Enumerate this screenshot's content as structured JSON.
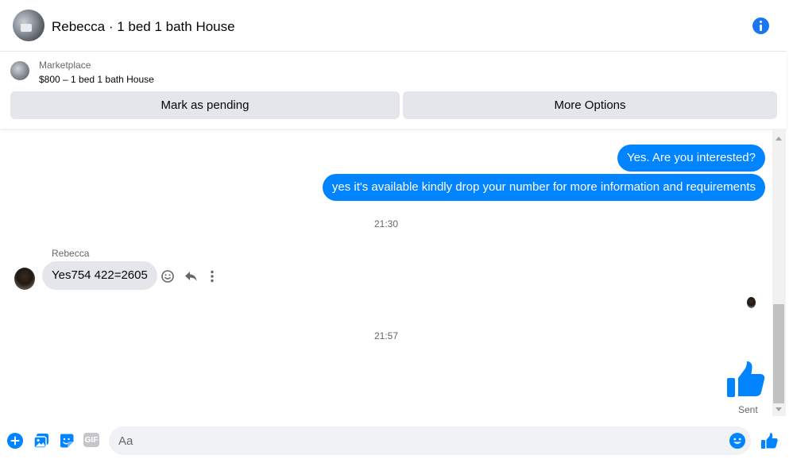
{
  "header": {
    "title": "Rebecca · 1 bed 1 bath House"
  },
  "listing": {
    "label": "Marketplace",
    "title": "$800 – 1 bed 1 bath House",
    "pending_label": "Mark as pending",
    "more_label": "More Options"
  },
  "thread": {
    "outgoing": [
      "Yes. Are you interested?",
      "yes it's available kindly drop your number for more information and requirements"
    ],
    "timestamp_1": "21:30",
    "sender_name": "Rebecca",
    "incoming": "Yes754 422=2605",
    "timestamp_2": "21:57",
    "sent_status": "Sent"
  },
  "composer": {
    "placeholder": "Aa",
    "gif_label": "GIF"
  },
  "colors": {
    "accent": "#0084ff",
    "brand": "#1877f2",
    "bubble_in": "#e4e6eb",
    "muted_text": "#65676b"
  }
}
